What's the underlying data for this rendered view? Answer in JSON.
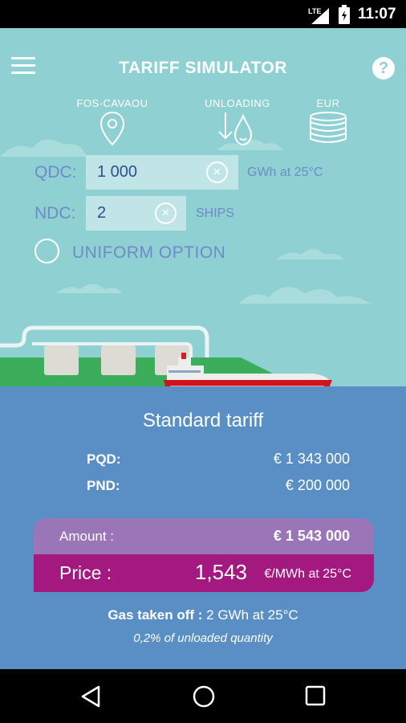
{
  "status_bar": {
    "network": "LTE",
    "time": "11:07"
  },
  "header": {
    "title": "TARIFF SIMULATOR",
    "menu_icon": "hamburger-menu-icon",
    "help_icon": "help-icon",
    "help_glyph": "?"
  },
  "params": [
    {
      "label": "FOS-CAVAOU",
      "icon": "location-pin-icon"
    },
    {
      "label": "UNLOADING",
      "icon": "unloading-icon"
    },
    {
      "label": "EUR",
      "icon": "coins-icon"
    }
  ],
  "form": {
    "qdc": {
      "label": "QDC:",
      "value": "1 000",
      "unit": "GWh at 25°C"
    },
    "ndc": {
      "label": "NDC:",
      "value": "2",
      "unit": "SHIPS"
    },
    "clear_glyph": "×",
    "uniform_option": {
      "label": "UNIFORM OPTION",
      "checked": false
    }
  },
  "results": {
    "title": "Standard tariff",
    "pqd": {
      "label": "PQD:",
      "value": "€ 1 343 000"
    },
    "pnd": {
      "label": "PND:",
      "value": "€ 200 000"
    },
    "amount": {
      "label": "Amount :",
      "value": "€ 1 543 000"
    },
    "price": {
      "label": "Price :",
      "value": "1,543",
      "unit": "€/MWh at 25°C"
    },
    "gas_taken_off": {
      "label": "Gas taken off :",
      "value": "2 GWh at 25°C"
    },
    "unloaded_pct": "0,2% of unloaded quantity"
  },
  "colors": {
    "sky": "#8fd0d2",
    "sea": "#5a8fc6",
    "amount_bg": "#9a75b8",
    "price_bg": "#a3197f",
    "label_blue": "#6e8ac7",
    "ship_red": "#d0141e",
    "land_green": "#3cae5b"
  }
}
